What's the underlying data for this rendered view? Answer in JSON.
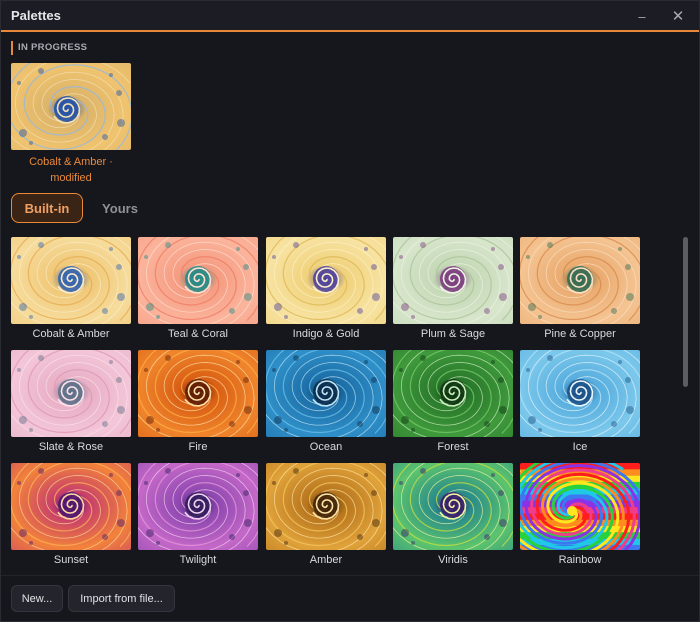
{
  "window": {
    "title": "Palettes",
    "minimize_icon": "minimize-icon",
    "close_icon": "close-icon"
  },
  "in_progress": {
    "section_label": "IN PROGRESS",
    "caption": "Cobalt & Amber · modified",
    "colors": {
      "bg": "#f0c36e",
      "mid": "#ddb56a",
      "deep": "#1f4fa8",
      "accent": "#8fb7e8",
      "core": "#f4e2b8"
    }
  },
  "tabs": [
    {
      "label": "Built-in",
      "active": true
    },
    {
      "label": "Yours",
      "active": false
    }
  ],
  "palettes": [
    {
      "name": "Cobalt & Amber",
      "colors": {
        "bg": "#f6dc9c",
        "mid": "#f0c878",
        "deep": "#2f62b0",
        "accent": "#e6a84e",
        "core": "#fbeccd"
      }
    },
    {
      "name": "Teal & Coral",
      "colors": {
        "bg": "#fbb49c",
        "mid": "#f59c82",
        "deep": "#1f8a86",
        "accent": "#ef7a62",
        "core": "#ffe2d4"
      }
    },
    {
      "name": "Indigo & Gold",
      "colors": {
        "bg": "#f7e3a2",
        "mid": "#f0d27c",
        "deep": "#4b3f9c",
        "accent": "#dcb652",
        "core": "#fdf1cc"
      }
    },
    {
      "name": "Plum & Sage",
      "colors": {
        "bg": "#d8e6cc",
        "mid": "#c4d8b6",
        "deep": "#7b3a7e",
        "accent": "#a8c296",
        "core": "#eef4e6"
      }
    },
    {
      "name": "Pine & Copper",
      "colors": {
        "bg": "#f4c492",
        "mid": "#eaab70",
        "deep": "#2f6a52",
        "accent": "#d7864a",
        "core": "#fbe2c6"
      }
    },
    {
      "name": "Slate & Rose",
      "colors": {
        "bg": "#f3c6d8",
        "mid": "#e9b0c6",
        "deep": "#5a6f86",
        "accent": "#dc95b0",
        "core": "#fbe4ec"
      }
    },
    {
      "name": "Fire",
      "colors": {
        "bg": "#f0852c",
        "mid": "#d95f14",
        "deep": "#5a1a06",
        "accent": "#ffb24a",
        "core": "#ffe2a8"
      }
    },
    {
      "name": "Ocean",
      "colors": {
        "bg": "#2f8fc8",
        "mid": "#1d6fa8",
        "deep": "#0a2a4a",
        "accent": "#6cc2ea",
        "core": "#bfe6f6"
      }
    },
    {
      "name": "Forest",
      "colors": {
        "bg": "#3f9a3c",
        "mid": "#2a7a2c",
        "deep": "#0e3412",
        "accent": "#7acb6a",
        "core": "#cdeebf"
      }
    },
    {
      "name": "Ice",
      "colors": {
        "bg": "#7cc8ec",
        "mid": "#58aede",
        "deep": "#1a4f86",
        "accent": "#b6e4f8",
        "core": "#eaf8fe"
      }
    },
    {
      "name": "Sunset",
      "colors": {
        "bg": "#f2823a",
        "mid": "#c8406a",
        "deep": "#4a1470",
        "accent": "#ffb45a",
        "core": "#ffd8a0"
      }
    },
    {
      "name": "Twilight",
      "colors": {
        "bg": "#c468c8",
        "mid": "#8e48b0",
        "deep": "#2e1c5a",
        "accent": "#e89ade",
        "core": "#f3d2f0"
      }
    },
    {
      "name": "Amber",
      "colors": {
        "bg": "#e0a23a",
        "mid": "#b8761e",
        "deep": "#3e2208",
        "accent": "#f6c860",
        "core": "#fde6a8"
      }
    },
    {
      "name": "Viridis",
      "colors": {
        "bg": "#5cc46c",
        "mid": "#2a8c8a",
        "deep": "#3a1a6a",
        "accent": "#c8e040",
        "core": "#eef6a0"
      }
    },
    {
      "name": "Rainbow",
      "colors": {
        "bg": "#f03c8c",
        "mid": "#3c78f0",
        "deep": "#ff1e1e",
        "accent": "#28d23c",
        "core": "#ffe61e"
      }
    }
  ],
  "footer": {
    "new_label": "New...",
    "import_label": "Import from file..."
  }
}
